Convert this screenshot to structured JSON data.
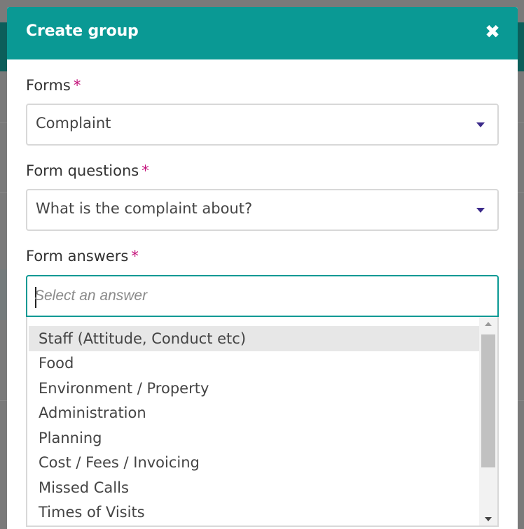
{
  "modal": {
    "title": "Create group",
    "close_icon": "close-icon"
  },
  "forms": {
    "label": "Forms",
    "required_mark": "*",
    "value": "Complaint"
  },
  "form_questions": {
    "label": "Form questions",
    "required_mark": "*",
    "value": "What is the complaint about?"
  },
  "form_answers": {
    "label": "Form answers",
    "required_mark": "*",
    "placeholder": "Select an answer",
    "options": [
      "Staff (Attitude, Conduct etc)",
      "Food",
      "Environment / Property",
      "Administration",
      "Planning",
      "Cost / Fees / Invoicing",
      "Missed Calls",
      "Times of Visits"
    ],
    "highlighted_option": "Staff (Attitude, Conduct etc)"
  },
  "colors": {
    "header": "#0a9994",
    "required": "#c4137b",
    "focus_border": "#0a9994",
    "caret": "#3b2a8a"
  }
}
